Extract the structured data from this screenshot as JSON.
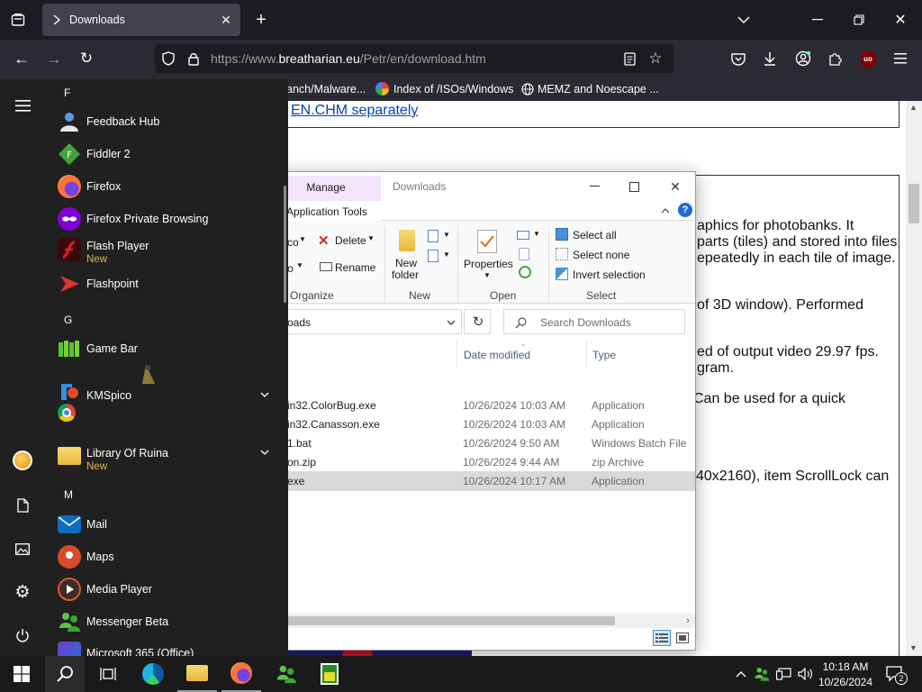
{
  "browser": {
    "tab_title": "Downloads",
    "url_prefix": "https://www.",
    "url_domain": "breatharian.eu",
    "url_path": "/Petr/en/download.htm",
    "bookmarks": [
      {
        "label": "anch/Malware...",
        "icon": "bookmark-icon"
      },
      {
        "label": "Index of /ISOs/Windows",
        "icon": "google-icon"
      },
      {
        "label": "MEMZ and Noescape ...",
        "icon": "globe-icon"
      }
    ],
    "ublock_label": "uo"
  },
  "webpage": {
    "link_text": "EN.CHM separately",
    "lines": [
      "aphics for photobanks. It",
      "parts (tiles) and stored into files",
      "epeatedly in each tile of image.",
      "of 3D window). Performed",
      "ed of output video 29.97 fps.",
      "gram.",
      "Can be used for a quick",
      "40x2160), item ScrollLock can"
    ]
  },
  "explorer": {
    "manage_tab": "Manage",
    "title": "Downloads",
    "app_tools_tab": "Application Tools",
    "ribbon": {
      "delete": "Delete",
      "rename": "Rename",
      "organize": "Organize",
      "new_folder_1": "New",
      "new_folder_2": "folder",
      "new_group": "New",
      "properties": "Properties",
      "open_group": "Open",
      "select_all": "Select all",
      "select_none": "Select none",
      "invert_selection": "Invert selection",
      "select_group": "Select",
      "cut_co": "co",
      "cut_o": "o"
    },
    "address": "oads",
    "search_placeholder": "Search Downloads",
    "columns": {
      "date": "Date modified",
      "type": "Type"
    },
    "files": [
      {
        "name": "in32.ColorBug.exe",
        "date": "10/26/2024 10:03 AM",
        "type": "Application"
      },
      {
        "name": "in32.Canasson.exe",
        "date": "10/26/2024 10:03 AM",
        "type": "Application"
      },
      {
        "name": "1.bat",
        "date": "10/26/2024 9:50 AM",
        "type": "Windows Batch File"
      },
      {
        "name": "on.zip",
        "date": "10/26/2024 9:44 AM",
        "type": "zip Archive"
      },
      {
        "name": "exe",
        "date": "10/26/2024 10:17 AM",
        "type": "Application"
      }
    ]
  },
  "startmenu": {
    "letters": {
      "f": "F",
      "g": "G",
      "m": "M"
    },
    "apps": [
      {
        "name": "Feedback Hub",
        "sub": ""
      },
      {
        "name": "Fiddler 2",
        "sub": ""
      },
      {
        "name": "Firefox",
        "sub": ""
      },
      {
        "name": "Firefox Private Browsing",
        "sub": ""
      },
      {
        "name": "Flash Player",
        "sub": "New"
      },
      {
        "name": "Flashpoint",
        "sub": ""
      },
      {
        "name": "Game Bar",
        "sub": ""
      },
      {
        "name": "KMSpico",
        "sub": ""
      },
      {
        "name": "Library Of Ruina",
        "sub": "New"
      },
      {
        "name": "Mail",
        "sub": ""
      },
      {
        "name": "Maps",
        "sub": ""
      },
      {
        "name": "Media Player",
        "sub": ""
      },
      {
        "name": "Messenger Beta",
        "sub": ""
      },
      {
        "name": "Microsoft 365 (Office)",
        "sub": ""
      }
    ]
  },
  "taskbar": {
    "time": "10:18 AM",
    "date": "10/26/2024",
    "notification_count": "2"
  },
  "colors": {
    "accent_link": "#0645ad",
    "selected_row": "#cce8ff",
    "manage_tab": "#f3e3fb",
    "new_badge": "#d9b656"
  }
}
